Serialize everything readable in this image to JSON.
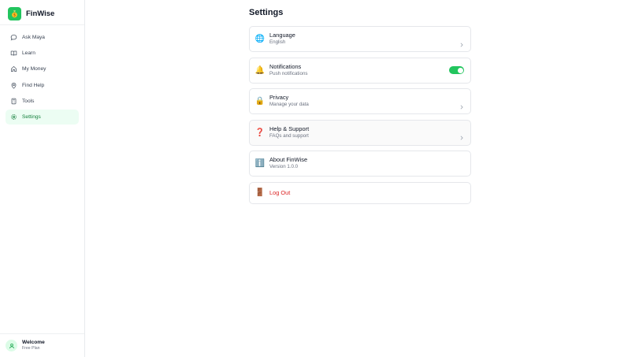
{
  "brand": {
    "name": "FinWise",
    "logo_icon": "money-bag-icon",
    "accent": "#22c55e"
  },
  "sidebar": {
    "items": [
      {
        "label": "Ask Maya",
        "icon": "chat-bubble-icon",
        "active": false
      },
      {
        "label": "Learn",
        "icon": "book-icon",
        "active": false
      },
      {
        "label": "My Money",
        "icon": "home-icon",
        "active": false
      },
      {
        "label": "Find Help",
        "icon": "location-pin-icon",
        "active": false
      },
      {
        "label": "Tools",
        "icon": "calculator-icon",
        "active": false
      },
      {
        "label": "Settings",
        "icon": "gear-icon",
        "active": true
      }
    ]
  },
  "user": {
    "name": "Welcome",
    "plan": "Free Plan",
    "icon": "user-icon"
  },
  "main": {
    "title": "Settings",
    "cards": [
      {
        "title": "Language",
        "subtitle": "English",
        "icon": "globe-icon",
        "emoji": "🌐",
        "control": "chevron"
      },
      {
        "title": "Notifications",
        "subtitle": "Push notifications",
        "icon": "bell-icon",
        "emoji": "🔔",
        "control": "toggle",
        "toggle_on": true
      },
      {
        "title": "Privacy",
        "subtitle": "Manage your data",
        "icon": "lock-icon",
        "emoji": "🔒",
        "control": "chevron"
      },
      {
        "title": "Help & Support",
        "subtitle": "FAQs and support",
        "icon": "question-icon",
        "emoji": "❓",
        "control": "chevron"
      },
      {
        "title": "About FinWise",
        "subtitle": "Version 1.0.0",
        "icon": "info-icon",
        "emoji": "ℹ️",
        "control": "none"
      },
      {
        "title": "Log Out",
        "icon": "door-icon",
        "emoji": "🚪",
        "control": "none",
        "color": "#dc2626"
      }
    ]
  }
}
